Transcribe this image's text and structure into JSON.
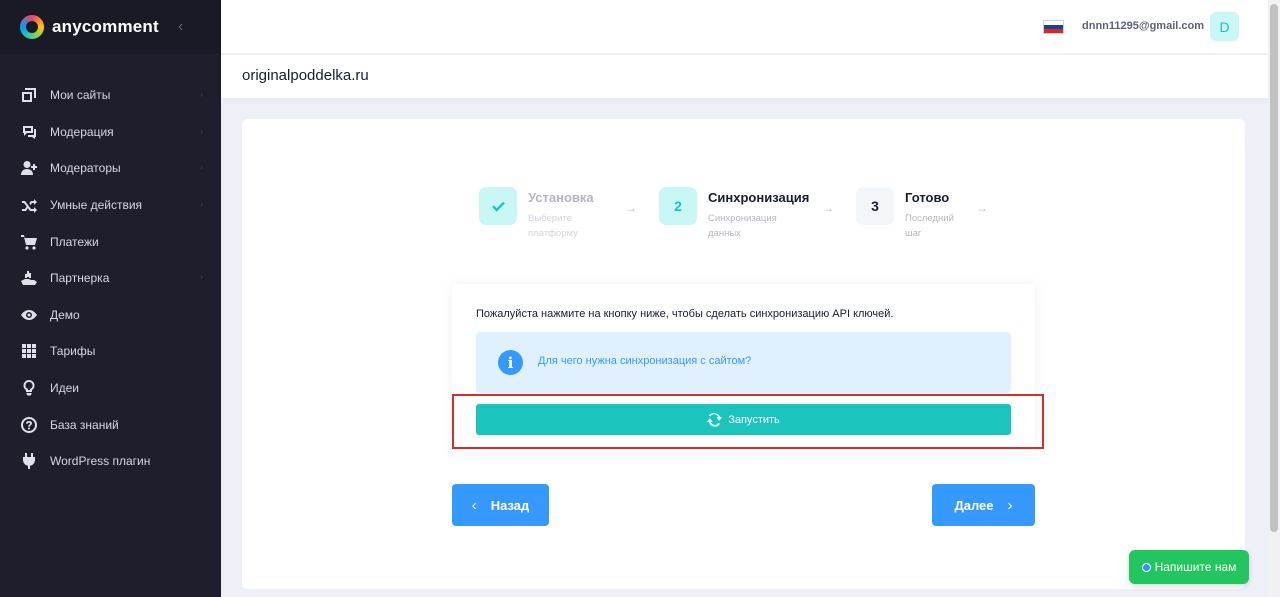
{
  "brand": {
    "name": "anycomment"
  },
  "sidebar": {
    "items": [
      {
        "label": "Мои сайты",
        "icon": "sites-icon",
        "caret": true
      },
      {
        "label": "Модерация",
        "icon": "moderation-chat-icon",
        "caret": true
      },
      {
        "label": "Модераторы",
        "icon": "moderators-user-icon",
        "caret": true
      },
      {
        "label": "Умные действия",
        "icon": "shuffle-icon",
        "caret": true
      },
      {
        "label": "Платежи",
        "icon": "cart-icon",
        "caret": false
      },
      {
        "label": "Партнерка",
        "icon": "partner-hand-icon",
        "caret": true
      },
      {
        "label": "Демо",
        "icon": "eye-icon",
        "caret": false
      },
      {
        "label": "Тарифы",
        "icon": "grid-icon",
        "caret": false
      },
      {
        "label": "Идеи",
        "icon": "lightbulb-icon",
        "caret": false
      },
      {
        "label": "База знаний",
        "icon": "question-icon",
        "caret": false
      },
      {
        "label": "WordPress плагин",
        "icon": "plug-icon",
        "caret": false
      }
    ]
  },
  "header": {
    "email": "dnnn11295@gmail.com",
    "avatar_letter": "D",
    "flag": "russia-flag"
  },
  "page": {
    "title": "originalpoddelka.ru"
  },
  "stepper": {
    "steps": [
      {
        "number": "",
        "title": "Установка",
        "desc": "Выберите платформу",
        "state": "done"
      },
      {
        "number": "2",
        "title": "Синхронизация",
        "desc": "Синхронизация данных",
        "state": "current"
      },
      {
        "number": "3",
        "title": "Готово",
        "desc": "Последний шаг",
        "state": "pending"
      }
    ]
  },
  "sync": {
    "instruction": "Пожалуйста нажмите на кнопку ниже, чтобы сделать синхронизацию API ключей.",
    "info_link": "Для чего нужна синхронизация с сайтом?",
    "run_label": "Запустить"
  },
  "nav_buttons": {
    "back_label": "Назад",
    "next_label": "Далее"
  },
  "chat": {
    "label": "Напишите нам"
  },
  "colors": {
    "accent": "#1bc5bd",
    "primary": "#3699ff",
    "sidebar": "#1e1e2d",
    "highlight": "#d32f2f"
  }
}
